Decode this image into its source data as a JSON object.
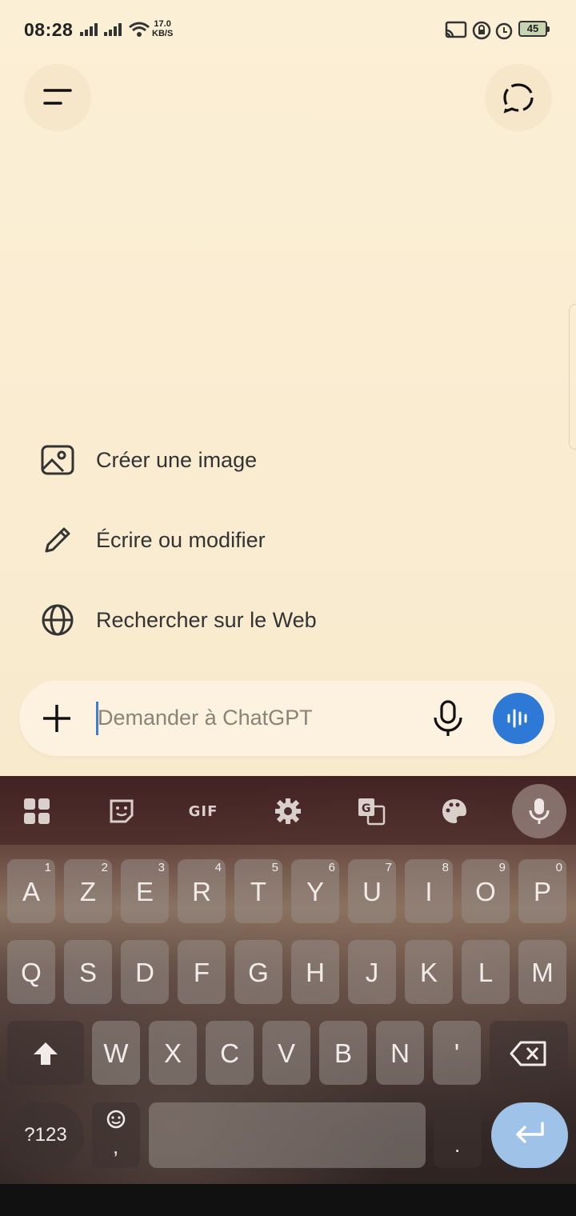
{
  "status_bar": {
    "time": "08:28",
    "net_speed_value": "17.0",
    "net_speed_unit": "KB/S",
    "battery": "45"
  },
  "header": {
    "menu_icon": "menu-icon",
    "new_chat_icon": "new-chat-icon"
  },
  "suggestions": [
    {
      "label": "Créer une image",
      "icon": "image-icon"
    },
    {
      "label": "Écrire ou modifier",
      "icon": "pencil-icon"
    },
    {
      "label": "Rechercher sur le Web",
      "icon": "globe-icon"
    }
  ],
  "composer": {
    "placeholder": "Demander à ChatGPT",
    "accent_color": "#2f79d6"
  },
  "keyboard": {
    "toolbar": {
      "gif_label": "GIF"
    },
    "row1": [
      {
        "key": "A",
        "num": "1"
      },
      {
        "key": "Z",
        "num": "2"
      },
      {
        "key": "E",
        "num": "3"
      },
      {
        "key": "R",
        "num": "4"
      },
      {
        "key": "T",
        "num": "5"
      },
      {
        "key": "Y",
        "num": "6"
      },
      {
        "key": "U",
        "num": "7"
      },
      {
        "key": "I",
        "num": "8"
      },
      {
        "key": "O",
        "num": "9"
      },
      {
        "key": "P",
        "num": "0"
      }
    ],
    "row2": [
      "Q",
      "S",
      "D",
      "F",
      "G",
      "H",
      "J",
      "K",
      "L",
      "M"
    ],
    "row3": [
      "W",
      "X",
      "C",
      "V",
      "B",
      "N",
      "'"
    ],
    "bottom": {
      "symbols_label": "?123",
      "comma": ",",
      "period": "."
    }
  }
}
